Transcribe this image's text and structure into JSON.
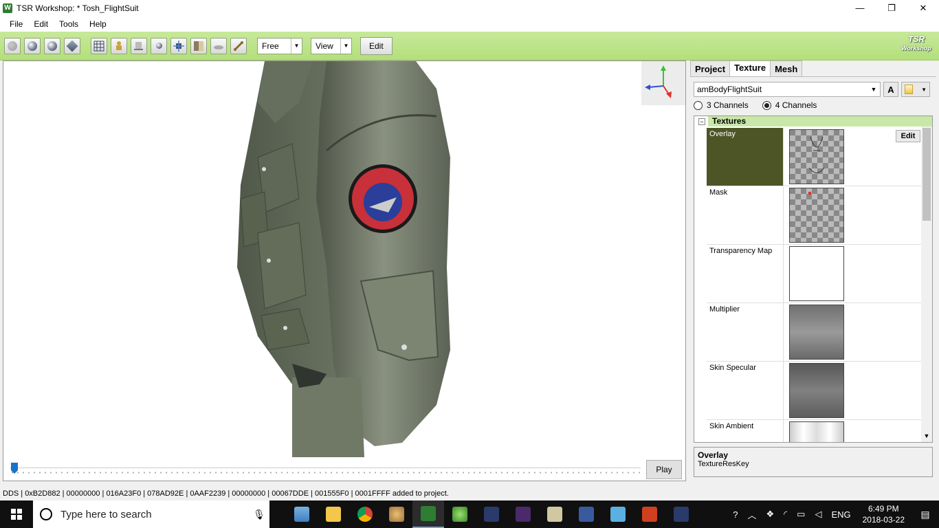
{
  "window": {
    "title": "TSR Workshop: * Tosh_FlightSuit",
    "icon_letter": "W",
    "minimize": "—",
    "maximize": "❐",
    "close": "✕"
  },
  "menu": [
    "File",
    "Edit",
    "Tools",
    "Help"
  ],
  "toolbar": {
    "mode_select": "Free",
    "view_select": "View",
    "edit_label": "Edit",
    "logo_line1": "TSR",
    "logo_line2": "Workshop"
  },
  "viewport": {
    "play_label": "Play"
  },
  "panel": {
    "tabs": [
      "Project",
      "Texture",
      "Mesh"
    ],
    "active_tab": "Texture",
    "texture_name": "amBodyFlightSuit",
    "a_button": "A",
    "channels": [
      {
        "label": "3 Channels",
        "selected": false
      },
      {
        "label": "4 Channels",
        "selected": true
      }
    ],
    "group_title": "Textures",
    "group_toggle": "−",
    "rows": [
      {
        "name": "Overlay",
        "thumb": "checker",
        "selected": true,
        "edit": "Edit"
      },
      {
        "name": "Mask",
        "thumb": "checker",
        "selected": false
      },
      {
        "name": "Transparency Map",
        "thumb": "white",
        "selected": false
      },
      {
        "name": "Multiplier",
        "thumb": "gray",
        "selected": false
      },
      {
        "name": "Skin Specular",
        "thumb": "dark",
        "selected": false
      },
      {
        "name": "Skin Ambient",
        "thumb": "light",
        "selected": false
      }
    ],
    "desc_title": "Overlay",
    "desc_text": "TextureResKey"
  },
  "status": "DDS | 0xB2D882 | 00000000 | 016A23F0 | 078AD92E | 0AAF2239 | 00000000 | 00067DDE | 001555F0 | 0001FFFF added to project.",
  "taskbar": {
    "search_placeholder": "Type here to search",
    "language": "ENG",
    "time": "6:49 PM",
    "date": "2018-03-22"
  },
  "colors": {
    "toolbar_green": "#b3df7b",
    "selected_row": "#4d5526",
    "group_header": "#c9e7a8",
    "suit": "#6d7563"
  }
}
